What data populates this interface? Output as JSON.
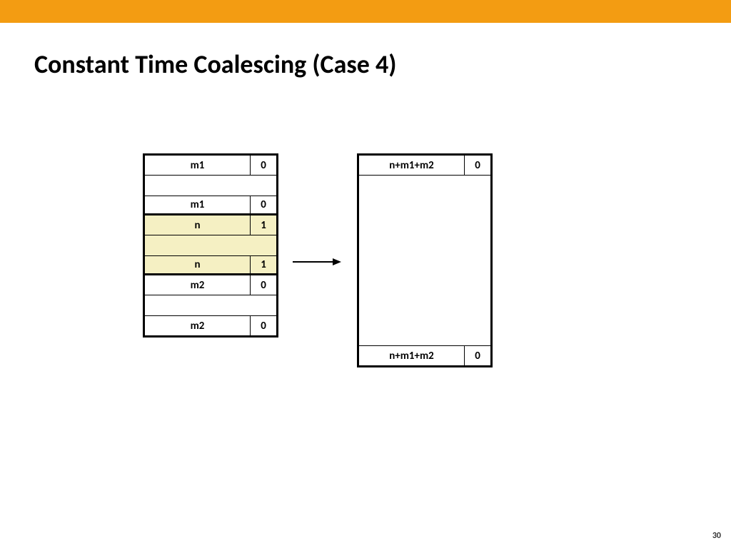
{
  "slide": {
    "title": "Constant Time Coalescing (Case 4)",
    "page_number": "30"
  },
  "colors": {
    "accent_bar": "#f39c12",
    "highlight": "#f5f0c3"
  },
  "left_block": {
    "r0": {
      "size": "m1",
      "flag": "0"
    },
    "r1": {
      "size": "m1",
      "flag": "0"
    },
    "r2": {
      "size": "n",
      "flag": "1"
    },
    "r3": {
      "size": "n",
      "flag": "1"
    },
    "r4": {
      "size": "m2",
      "flag": "0"
    },
    "r5": {
      "size": "m2",
      "flag": "0"
    }
  },
  "right_block": {
    "top": {
      "size": "n+m1+m2",
      "flag": "0"
    },
    "bottom": {
      "size": "n+m1+m2",
      "flag": "0"
    }
  }
}
